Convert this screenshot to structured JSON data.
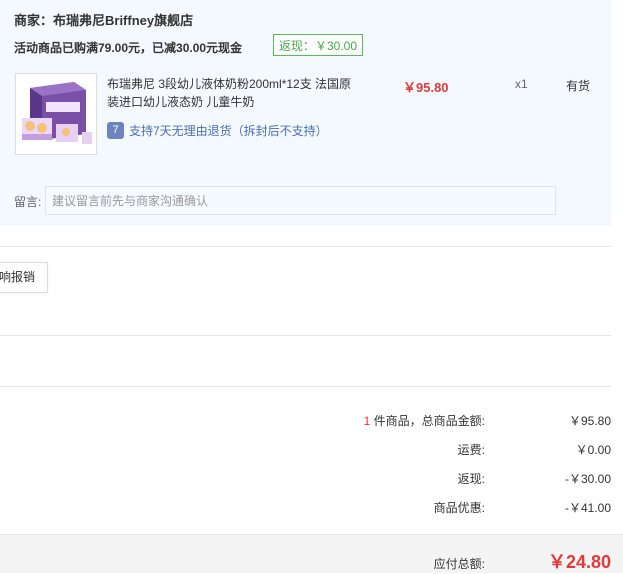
{
  "shop": {
    "merchant": "商家：布瑞弗尼Briffney旗舰店",
    "promo": "活动商品已购满79.00元，已减30.00元现金",
    "rebate_tag": "返现：￥30.00"
  },
  "product": {
    "name": "布瑞弗尼 3段幼儿液体奶粉200ml*12支 法国原装进口幼儿液态奶 儿童牛奶",
    "return_icon": "7",
    "return_policy": "支持7天无理由退货（拆封后不支持）",
    "price": "￥95.80",
    "qty": "x1",
    "stock": "有货"
  },
  "memo": {
    "label": "留言:",
    "placeholder": "建议留言前先与商家沟通确认"
  },
  "reimburse_button": "响报销",
  "summary": {
    "count": "1",
    "count_suffix": " 件商品，总商品金额:",
    "goods_amount": "￥95.80",
    "shipping_label": "运费:",
    "shipping": "￥0.00",
    "rebate_label": "返现:",
    "rebate": "-￥30.00",
    "discount_label": "商品优惠:",
    "discount": "-￥41.00",
    "total_label": "应付总额:",
    "total": "￥24.80"
  },
  "colors": {
    "price_red": "#e4393c",
    "rebate_green": "#4aa84a",
    "link_blue": "#4d6fb6",
    "shop_bg": "#f3f9fd"
  },
  "icons": {
    "return_icon": "seven-day-return-icon",
    "thumb": "product-thumbnail"
  }
}
